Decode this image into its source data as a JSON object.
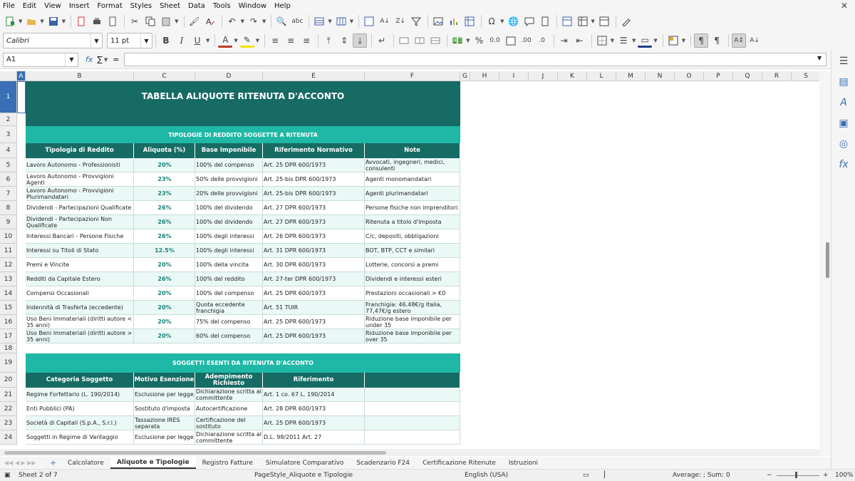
{
  "menu": [
    "File",
    "Edit",
    "View",
    "Insert",
    "Format",
    "Styles",
    "Sheet",
    "Data",
    "Tools",
    "Window",
    "Help"
  ],
  "toolbar": {
    "font_name": "Calibri",
    "font_size": "11 pt"
  },
  "formula_bar": {
    "cell_ref": "A1",
    "fx": "fx",
    "sigma": "∑",
    "equals": "="
  },
  "columns": [
    "A",
    "B",
    "C",
    "D",
    "E",
    "F",
    "G",
    "H",
    "I",
    "J",
    "K",
    "L",
    "M",
    "N",
    "O",
    "P",
    "Q",
    "R",
    "S"
  ],
  "rows": [
    "1",
    "2",
    "3",
    "4",
    "5",
    "6",
    "7",
    "8",
    "9",
    "10",
    "11",
    "12",
    "13",
    "14",
    "15",
    "16",
    "17",
    "18",
    "19",
    "20",
    "21",
    "22",
    "23",
    "24"
  ],
  "sheet": {
    "title": "TABELLA ALIQUOTE RITENUTA D'ACCONTO",
    "section1_title": "TIPOLOGIE DI REDDITO SOGGETTE A RITENUTA",
    "table1_headers": [
      "Tipologia di Reddito",
      "Aliquota (%)",
      "Base Imponibile",
      "Riferimento Normativo",
      "Note"
    ],
    "table1_rows": [
      [
        "Lavoro Autonomo - Professionisti",
        "20%",
        "100% del compenso",
        "Art. 25 DPR 600/1973",
        "Avvocati, ingegneri, medici, consulenti"
      ],
      [
        "Lavoro Autonomo - Provvigioni Agenti",
        "23%",
        "50% delle provvigioni",
        "Art. 25-bis DPR 600/1973",
        "Agenti monomandatari"
      ],
      [
        "Lavoro Autonomo - Provvigioni Plurimandatari",
        "23%",
        "20% delle provvigioni",
        "Art. 25-bis DPR 600/1973",
        "Agenti plurimandatari"
      ],
      [
        "Dividendi - Partecipazioni Qualificate",
        "26%",
        "100% del dividendo",
        "Art. 27 DPR 600/1973",
        "Persone fisiche non imprenditori"
      ],
      [
        "Dividendi - Partecipazioni Non Qualificate",
        "26%",
        "100% del dividendo",
        "Art. 27 DPR 600/1973",
        "Ritenuta a titolo d'imposta"
      ],
      [
        "Interessi Bancari - Persone Fisiche",
        "26%",
        "100% degli interessi",
        "Art. 26 DPR 600/1973",
        "C/c, depositi, obbligazioni"
      ],
      [
        "Interessi su Titoli di Stato",
        "12.5%",
        "100% degli interessi",
        "Art. 31 DPR 600/1973",
        "BOT, BTP, CCT e similari"
      ],
      [
        "Premi e Vincite",
        "20%",
        "100% della vincita",
        "Art. 30 DPR 600/1973",
        "Lotterie, concorsi a premi"
      ],
      [
        "Redditi da Capitale Estero",
        "26%",
        "100% del reddito",
        "Art. 27-ter DPR 600/1973",
        "Dividendi e interessi esteri"
      ],
      [
        "Compensi Occasionali",
        "20%",
        "100% del compenso",
        "Art. 25 DPR 600/1973",
        "Prestazioni occasionali > €0"
      ],
      [
        "Indennità di Trasferta (eccedente)",
        "20%",
        "Quota eccedente franchigia",
        "Art. 51 TUIR",
        "Franchigia: 46,48€/g Italia, 77,47€/g estero"
      ],
      [
        "Uso Beni Immateriali (diritti autore < 35 anni)",
        "20%",
        "75% del compenso",
        "Art. 25 DPR 600/1973",
        "Riduzione base imponibile per under 35"
      ],
      [
        "Uso Beni Immateriali (diritti autore > 35 anni)",
        "20%",
        "60% del compenso",
        "Art. 25 DPR 600/1973",
        "Riduzione base imponibile per over 35"
      ]
    ],
    "section2_title": "SOGGETTI ESENTI DA RITENUTA D'ACCONTO",
    "table2_headers": [
      "Categoria Soggetto",
      "Motivo Esenzione",
      "Adempimento Richiesto",
      "Riferimento",
      ""
    ],
    "table2_rows": [
      [
        "Regime Forfettario (L. 190/2014)",
        "Esclusione per legge",
        "Dichiarazione scritta al committente",
        "Art. 1 co. 67 L. 190/2014",
        ""
      ],
      [
        "Enti Pubblici (PA)",
        "Sostituto d'imposta",
        "Autocertificazione",
        "Art. 28 DPR 600/1973",
        ""
      ],
      [
        "Società di Capitali (S.p.A., S.r.l.)",
        "Tassazione IRES separata",
        "Certificazione del sostituto",
        "Art. 25 DPR 600/1973",
        ""
      ],
      [
        "Soggetti in Regime di Vantaggio",
        "Esclusione per legge",
        "Dichiarazione scritta al committente",
        "D.L. 98/2011 Art. 27",
        ""
      ]
    ]
  },
  "tabs": [
    "Calcolatore",
    "Aliquote e Tipologie",
    "Registro Fatture",
    "Simulatore Comparativo",
    "Scadenzario F24",
    "Certificazione Ritenute",
    "Istruzioni"
  ],
  "active_tab": "Aliquote e Tipologie",
  "status": {
    "sheet": "Sheet 2 of 7",
    "page_style": "PageStyle_Aliquote e Tipologie",
    "language": "English (USA)",
    "sum": "Average: ; Sum: 0",
    "zoom": "100%"
  },
  "colors": {
    "dark_teal": "#166b64",
    "light_teal": "#1fb7a6",
    "row_alt": "#eaf8f6"
  }
}
